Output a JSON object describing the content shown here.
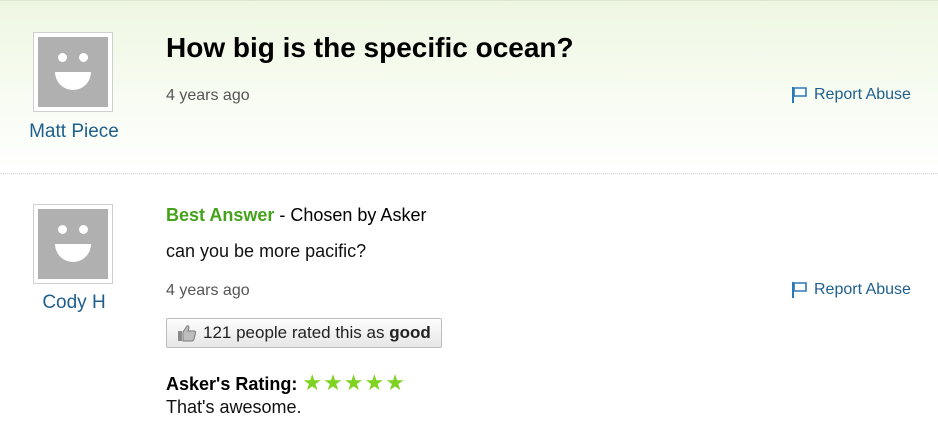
{
  "question": {
    "asker": {
      "name": "Matt Piece",
      "avatar": "default-avatar"
    },
    "title": "How big is the specific ocean?",
    "time": "4 years ago",
    "report_label": "Report Abuse"
  },
  "answer": {
    "author": {
      "name": "Cody H",
      "avatar": "default-avatar"
    },
    "best_label": "Best Answer",
    "chosen_text": " - Chosen by Asker",
    "text": "can you be more pacific?",
    "time": "4 years ago",
    "report_label": "Report Abuse",
    "rating_button": {
      "text": "121 people rated this as ",
      "emphasis": "good",
      "icon": "thumbs-up-icon"
    },
    "asker_rating": {
      "label": "Asker's Rating:",
      "stars": "★★★★★",
      "stars_value": 5,
      "comment": "That's awesome."
    }
  },
  "colors": {
    "link_blue": "#1f5f8e",
    "best_green": "#44a31a",
    "star_green": "#7ed321",
    "avatar_gray": "#b0b0b0"
  },
  "icons": [
    "flag-icon",
    "thumbs-up-icon",
    "star-icon",
    "avatar-face-icon"
  ]
}
